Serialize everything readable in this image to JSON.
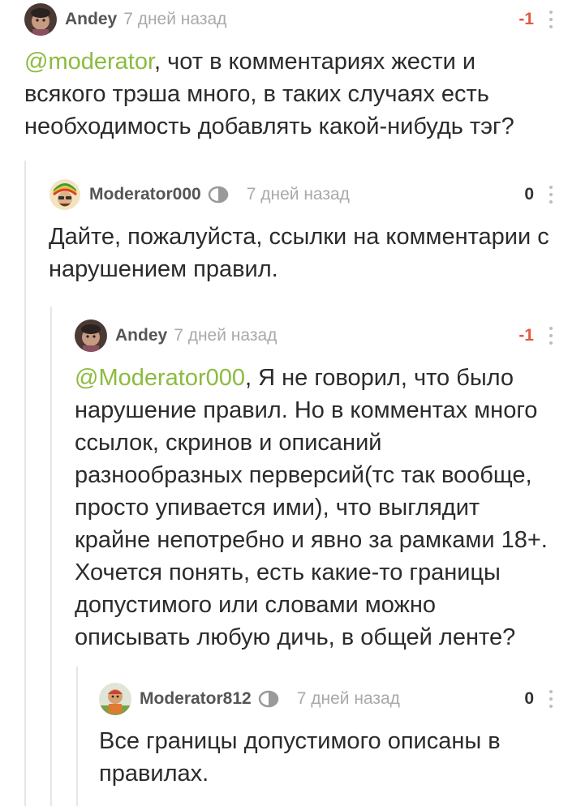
{
  "colors": {
    "mention": "#8cbb3e",
    "negative_rating": "#e05a44",
    "thread_line": "#e6e6e6",
    "username": "#555555",
    "timestamp": "#a9a9a9"
  },
  "comments": [
    {
      "username": "Andey",
      "avatar": "avatar-andey",
      "is_moderator": false,
      "timestamp": "7 дней назад",
      "rating": "-1",
      "mention": "@moderator",
      "text": ", чот в комментариях жести и всякого трэша много, в таких случаях есть необходимость добавлять какой-нибудь тэг?"
    },
    {
      "username": "Moderator000",
      "avatar": "avatar-moderator000",
      "is_moderator": true,
      "timestamp": "7 дней назад",
      "rating": "0",
      "text": "Дайте, пожалуйста, ссылки на комментарии с нарушением правил."
    },
    {
      "username": "Andey",
      "avatar": "avatar-andey",
      "is_moderator": false,
      "timestamp": "7 дней назад",
      "rating": "-1",
      "mention": "@Moderator000",
      "text": ",  Я не говорил, что было нарушение правил. Но в комментах много ссылок, скринов и описаний разнообразных перверсий(тс так вообще, просто упивается ими), что выглядит крайне непотребно и явно за рамками 18+. Хочется понять, есть какие-то границы допустимого или словами можно описывать любую дичь, в общей ленте?"
    },
    {
      "username": "Moderator812",
      "avatar": "avatar-moderator812",
      "is_moderator": true,
      "timestamp": "7 дней назад",
      "rating": "0",
      "text": "Все границы допустимого описаны в правилах."
    }
  ]
}
